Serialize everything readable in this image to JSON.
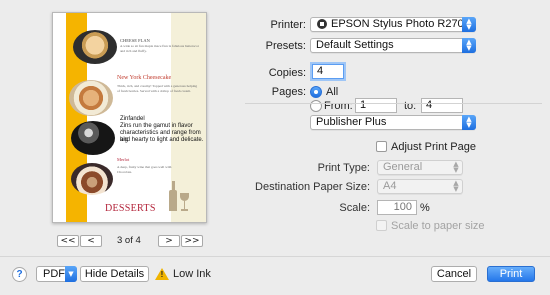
{
  "preview": {
    "page1_title": "CHEESE FLAN",
    "page1_line1": "A wide so sit fun maple mace flan la fabulous butterscot",
    "page1_line2": "and rich and fluffy.",
    "page2_title": "New York Cheesecake",
    "page2_line1": "Thick, rich, and creamy! Topped with a generous helping",
    "page2_line2": "of fresh berries. Served with a dollop of fresh cream.",
    "page3_title": "Zinfandel",
    "page3_line1": "Zins run the gamut in flavor",
    "page3_line2": "characteristics and range from big",
    "page3_line3": "and hearty to light and delicate.",
    "page4_title": "Merlot",
    "page4_line1": "A deep, fruity wine that goes well with",
    "page4_line2": "Chocolate.",
    "desserts_heading": "DESSERTS",
    "stripe_color": "#f5b400"
  },
  "page_nav": {
    "first": "<<",
    "prev": "<",
    "indicator": "3 of 4",
    "next": ">",
    "last": ">>"
  },
  "printer": {
    "label": "Printer:",
    "value": "EPSON Stylus Photo R270"
  },
  "presets": {
    "label": "Presets:",
    "value": "Default Settings"
  },
  "copies": {
    "label": "Copies:",
    "value": "4"
  },
  "pages": {
    "label": "Pages:",
    "all_label": "All",
    "from_label": "From:",
    "from_value": "1",
    "to_label": "to:",
    "to_value": "4"
  },
  "section_popup": {
    "value": "Publisher Plus"
  },
  "adjust_print_page": {
    "label": "Adjust Print Page"
  },
  "print_type": {
    "label": "Print Type:",
    "value": "General"
  },
  "destination_paper_size": {
    "label": "Destination Paper Size:",
    "value": "A4"
  },
  "scale": {
    "label": "Scale:",
    "value": "100",
    "unit": "%"
  },
  "scale_to_paper": {
    "label": "Scale to paper size"
  },
  "bottom": {
    "help": "?",
    "pdf": "PDF",
    "hide_details": "Hide Details",
    "low_ink": "Low Ink",
    "cancel": "Cancel",
    "print": "Print"
  },
  "accent_color": "#2577ea"
}
